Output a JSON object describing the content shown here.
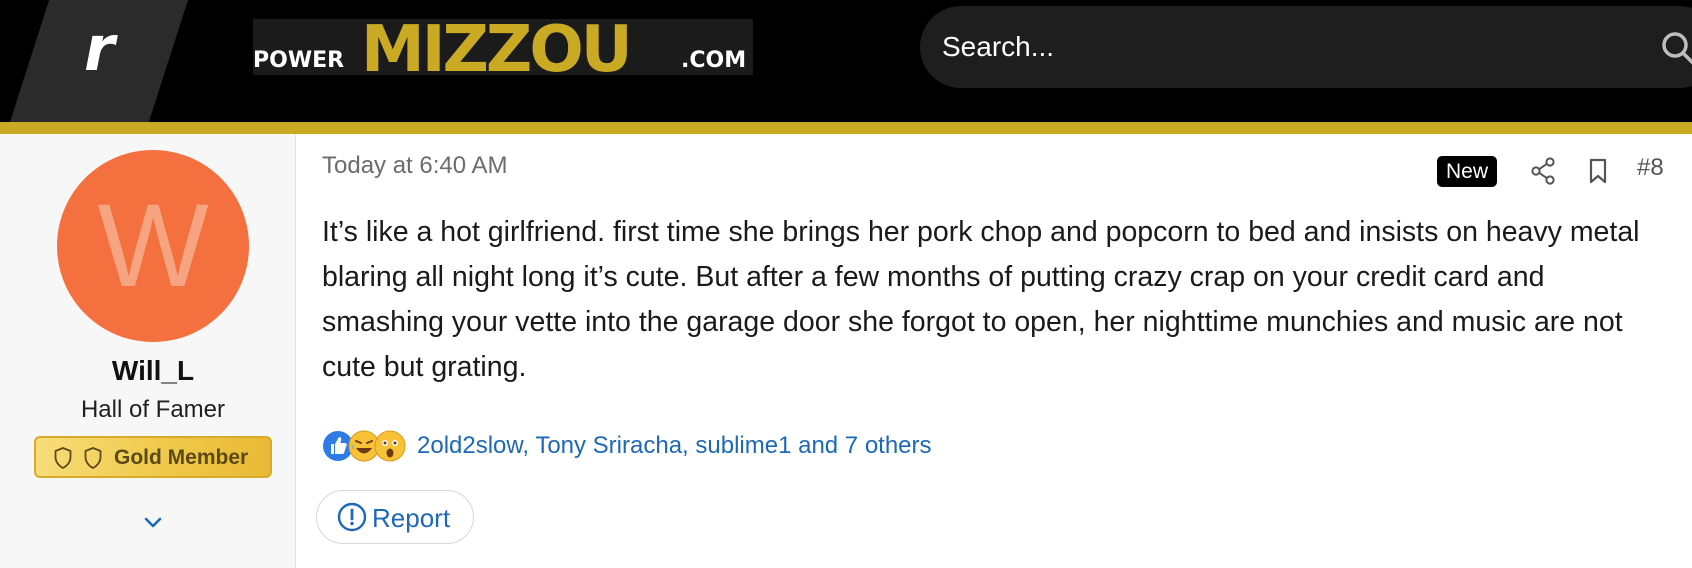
{
  "header": {
    "network_logo_letter": "r",
    "site_logo": {
      "prefix": "POWER",
      "name": "MIZZOU",
      "suffix": ".COM"
    },
    "search": {
      "placeholder": "Search..."
    }
  },
  "colors": {
    "accent_gold": "#c9aa22",
    "avatar_bg": "#f5703f",
    "link_blue": "#1e68b8"
  },
  "author": {
    "avatar_letter": "W",
    "username": "Will_L",
    "title": "Hall of Famer",
    "badge": "Gold Member"
  },
  "post": {
    "timestamp": "Today at 6:40 AM",
    "new_label": "New",
    "number": "#8",
    "message": "It’s like a hot girlfriend. first time she brings her pork chop and popcorn to bed and insists on heavy metal blaring all night long it’s cute. But after a few months of putting crazy crap on your credit card and smashing your vette into the garage door she forgot to open, her nighttime munchies and music are not cute but grating.",
    "reactions": {
      "icons": [
        "like-icon",
        "laugh-icon",
        "wow-icon"
      ],
      "names": "2old2slow, Tony Sriracha, sublime1 and 7 others"
    },
    "report_label": "Report"
  }
}
